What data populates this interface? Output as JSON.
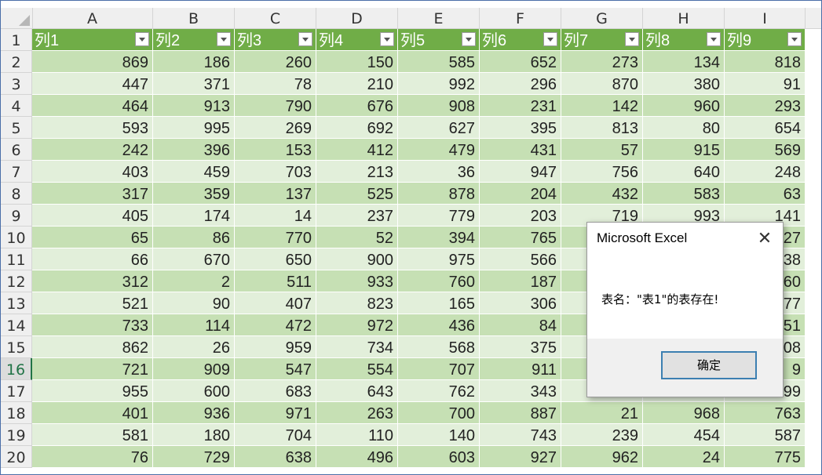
{
  "spreadsheet": {
    "column_letters": [
      "A",
      "B",
      "C",
      "D",
      "E",
      "F",
      "G",
      "H",
      "I"
    ],
    "row_numbers": [
      "1",
      "2",
      "3",
      "4",
      "5",
      "6",
      "7",
      "8",
      "9",
      "10",
      "11",
      "12",
      "13",
      "14",
      "15",
      "16",
      "17",
      "18",
      "19",
      "20"
    ],
    "active_row": "16",
    "table": {
      "headers": [
        "列1",
        "列2",
        "列3",
        "列4",
        "列5",
        "列6",
        "列7",
        "列8",
        "列9"
      ],
      "rows": [
        [
          "869",
          "186",
          "260",
          "150",
          "585",
          "652",
          "273",
          "134",
          "818"
        ],
        [
          "447",
          "371",
          "78",
          "210",
          "992",
          "296",
          "870",
          "380",
          "91"
        ],
        [
          "464",
          "913",
          "790",
          "676",
          "908",
          "231",
          "142",
          "960",
          "293"
        ],
        [
          "593",
          "995",
          "269",
          "692",
          "627",
          "395",
          "813",
          "80",
          "654"
        ],
        [
          "242",
          "396",
          "153",
          "412",
          "479",
          "431",
          "57",
          "915",
          "569"
        ],
        [
          "403",
          "459",
          "703",
          "213",
          "36",
          "947",
          "756",
          "640",
          "248"
        ],
        [
          "317",
          "359",
          "137",
          "525",
          "878",
          "204",
          "432",
          "583",
          "63"
        ],
        [
          "405",
          "174",
          "14",
          "237",
          "779",
          "203",
          "719",
          "993",
          "141"
        ],
        [
          "65",
          "86",
          "770",
          "52",
          "394",
          "765",
          "",
          "",
          "27"
        ],
        [
          "66",
          "670",
          "650",
          "900",
          "975",
          "566",
          "",
          "",
          "38"
        ],
        [
          "312",
          "2",
          "511",
          "933",
          "760",
          "187",
          "",
          "",
          "60"
        ],
        [
          "521",
          "90",
          "407",
          "823",
          "165",
          "306",
          "",
          "",
          "77"
        ],
        [
          "733",
          "114",
          "472",
          "972",
          "436",
          "84",
          "",
          "",
          "51"
        ],
        [
          "862",
          "26",
          "959",
          "734",
          "568",
          "375",
          "",
          "",
          "08"
        ],
        [
          "721",
          "909",
          "547",
          "554",
          "707",
          "911",
          "",
          "",
          "9"
        ],
        [
          "955",
          "600",
          "683",
          "643",
          "762",
          "343",
          "",
          "",
          "99"
        ],
        [
          "401",
          "936",
          "971",
          "263",
          "700",
          "887",
          "21",
          "968",
          "763"
        ],
        [
          "581",
          "180",
          "704",
          "110",
          "140",
          "743",
          "239",
          "454",
          "587"
        ],
        [
          "76",
          "729",
          "638",
          "496",
          "603",
          "927",
          "962",
          "24",
          "775"
        ]
      ]
    },
    "colors": {
      "header": "#70ad47",
      "band_dark": "#c6e0b4",
      "band_light": "#e2efda"
    }
  },
  "dialog": {
    "title": "Microsoft Excel",
    "close_icon": "close-icon",
    "message": "表名：\"表1\"的表存在!",
    "ok_label": "确定"
  }
}
